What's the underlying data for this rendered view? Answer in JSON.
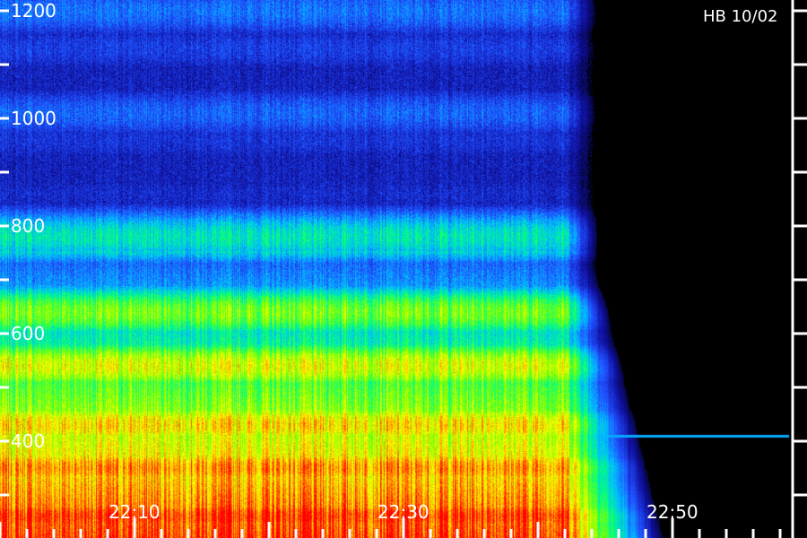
{
  "label_text": "HB 10/02",
  "chart_data": {
    "type": "heatmap",
    "title": "",
    "xlabel": "",
    "ylabel": "",
    "y_ticks": [
      1200,
      1000,
      800,
      600,
      400
    ],
    "x_ticks": [
      "22:10",
      "22:30",
      "22:50"
    ],
    "ylim": [
      200,
      1200
    ],
    "grid": false,
    "legend": "none",
    "colormap": [
      "#000000",
      "#1010a0",
      "#2050ff",
      "#00c0ff",
      "#00ff80",
      "#80ff00",
      "#ffff00",
      "#ff8000",
      "#ff0000"
    ],
    "signal_end_time": "22:42",
    "bands": [
      {
        "center": 1200,
        "intensity": 0.32
      },
      {
        "center": 1130,
        "intensity": 0.24
      },
      {
        "center": 1010,
        "intensity": 0.3
      },
      {
        "center": 960,
        "intensity": 0.22
      },
      {
        "center": 860,
        "intensity": 0.2
      },
      {
        "center": 780,
        "intensity": 0.5
      },
      {
        "center": 640,
        "intensity": 0.62
      },
      {
        "center": 540,
        "intensity": 0.72
      },
      {
        "center": 430,
        "intensity": 0.78
      },
      {
        "center": 350,
        "intensity": 0.86
      },
      {
        "center": 260,
        "intensity": 0.96
      }
    ],
    "weak_trace": {
      "start_time": "22:42",
      "end_time": "23:00",
      "level": 410
    }
  }
}
